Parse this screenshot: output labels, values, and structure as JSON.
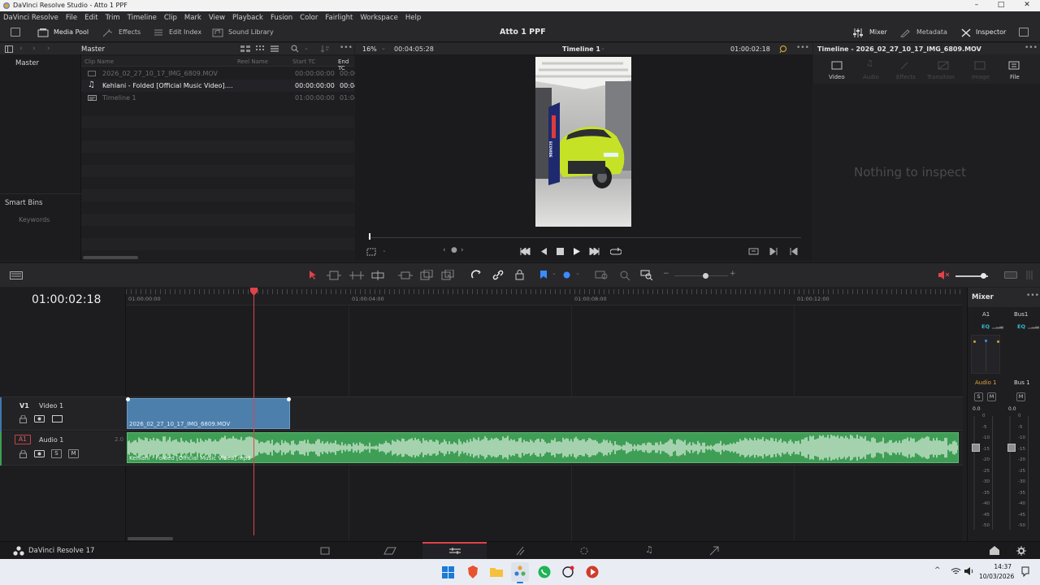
{
  "window": {
    "title": "DaVinci Resolve Studio - Atto 1 PPF"
  },
  "menu": [
    "DaVinci Resolve",
    "File",
    "Edit",
    "Trim",
    "Timeline",
    "Clip",
    "Mark",
    "View",
    "Playback",
    "Fusion",
    "Color",
    "Fairlight",
    "Workspace",
    "Help"
  ],
  "toolbar": {
    "media_pool": "Media Pool",
    "effects": "Effects",
    "edit_index": "Edit Index",
    "sound_library": "Sound Library",
    "project_title": "Atto 1 PPF",
    "mixer": "Mixer",
    "metadata": "Metadata",
    "inspector": "Inspector"
  },
  "bins": {
    "master": "Master",
    "smart_bins": "Smart Bins",
    "keywords": "Keywords"
  },
  "media_pool": {
    "folder": "Master",
    "columns": [
      "Clip Name",
      "Reel Name",
      "Start TC",
      "End TC"
    ],
    "clips": [
      {
        "name": "2026_02_27_10_17_IMG_6809.MOV",
        "start": "00:00:00:00",
        "end": "00:00",
        "icon": "video-clip-icon"
      },
      {
        "name": "Kehlani - Folded [Official Music Video]....",
        "start": "00:00:00:00",
        "end": "00:04",
        "icon": "music-icon"
      },
      {
        "name": "Timeline 1",
        "start": "01:00:00:00",
        "end": "01:04",
        "icon": "timeline-icon"
      }
    ]
  },
  "viewer": {
    "zoom": "16%",
    "duration": "00:04:05:28",
    "timeline_name": "Timeline 1",
    "timecode": "01:00:02:18",
    "overlay_text": "ECOVIDE"
  },
  "inspector": {
    "title": "Timeline - 2026_02_27_10_17_IMG_6809.MOV",
    "tabs": [
      "Video",
      "Audio",
      "Effects",
      "Transition",
      "Image",
      "File"
    ],
    "empty": "Nothing to inspect"
  },
  "timeline": {
    "timecode": "01:00:02:18",
    "ruler": [
      "01:00:00:00",
      "01:00:04:00",
      "01:00:08:00",
      "01:00:12:00"
    ],
    "video_track": {
      "id": "V1",
      "name": "Video 1",
      "clip": "2026_02_27_10_17_IMG_6809.MOV"
    },
    "audio_track": {
      "id": "A1",
      "name": "Audio 1",
      "level": "2.0",
      "clip": "Kehlani - Folded [Official Music Video].mp3",
      "solo": "S",
      "mute": "M"
    }
  },
  "mixer": {
    "title": "Mixer",
    "strips": [
      "A1",
      "Bus1"
    ],
    "eq": "EQ",
    "names": [
      "Audio 1",
      "Bus 1"
    ],
    "buttons": [
      "S",
      "M",
      "M"
    ],
    "db_values": [
      "0.0",
      "0.0"
    ],
    "scale": [
      "0",
      "-5",
      "-10",
      "-15",
      "-20",
      "-25",
      "-30",
      "-35",
      "-40",
      "-45",
      "-50"
    ]
  },
  "bottom": {
    "app": "DaVinci Resolve 17",
    "pages": [
      "media-page-icon",
      "cut-page-icon",
      "edit-page-icon",
      "fusion-page-icon",
      "color-page-icon",
      "fairlight-page-icon",
      "deliver-page-icon"
    ]
  },
  "taskbar": {
    "time": "14:37",
    "date": "10/03/2026"
  },
  "colors": {
    "accent_red": "#e0434a",
    "video_clip": "#4c7fac",
    "audio_clip": "#3f9e55",
    "selection_blue": "#2f6fbf"
  }
}
